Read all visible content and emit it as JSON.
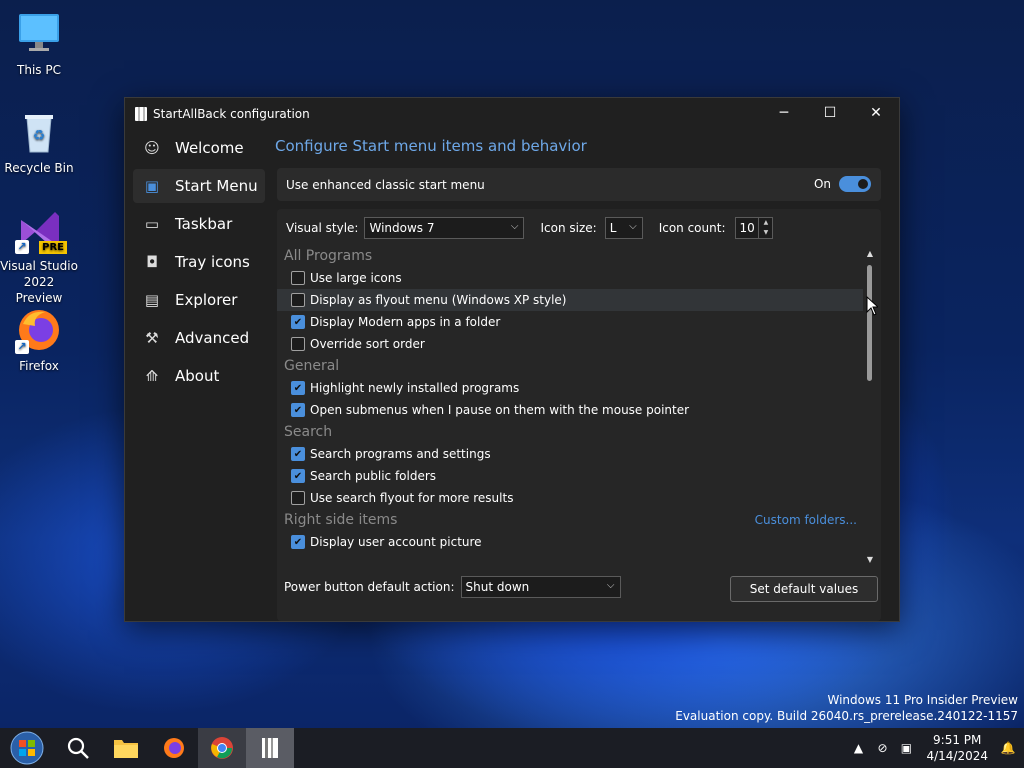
{
  "desktop": {
    "icons": [
      {
        "label": "This PC",
        "icon": "monitor-icon"
      },
      {
        "label": "Recycle Bin",
        "icon": "recycle-bin-icon"
      },
      {
        "label": "Visual Studio 2022 Preview",
        "badge": "PRE",
        "icon": "visual-studio-icon"
      },
      {
        "label": "Firefox",
        "icon": "firefox-icon"
      }
    ],
    "watermark": {
      "line1": "Windows 11 Pro Insider Preview",
      "line2": "Evaluation copy. Build 26040.rs_prerelease.240122-1157"
    }
  },
  "window": {
    "title": "StartAllBack configuration",
    "controls": {
      "minimize": "─",
      "maximize": "☐",
      "close": "✕"
    },
    "nav": [
      {
        "label": "Welcome",
        "icon": "smile-icon",
        "glyph": "☺"
      },
      {
        "label": "Start Menu",
        "icon": "start-menu-icon",
        "glyph": "▣"
      },
      {
        "label": "Taskbar",
        "icon": "taskbar-icon",
        "glyph": "▭"
      },
      {
        "label": "Tray icons",
        "icon": "tray-icon",
        "glyph": "◘"
      },
      {
        "label": "Explorer",
        "icon": "folder-icon",
        "glyph": "▤"
      },
      {
        "label": "Advanced",
        "icon": "wrench-icon",
        "glyph": "⚒"
      },
      {
        "label": "About",
        "icon": "info-icon",
        "glyph": "⟰"
      }
    ],
    "active_nav": "Start Menu",
    "page_title": "Configure Start menu items and behavior",
    "enhanced": {
      "label": "Use enhanced classic start menu",
      "state_label": "On",
      "on": true
    },
    "options": {
      "visual_style_label": "Visual style:",
      "visual_style_value": "Windows 7",
      "icon_size_label": "Icon size:",
      "icon_size_value": "L",
      "icon_count_label": "Icon count:",
      "icon_count_value": "10"
    },
    "sections": {
      "all_programs": "All Programs",
      "general": "General",
      "search": "Search",
      "right_side": "Right side items",
      "custom_folders_link": "Custom folders..."
    },
    "items": {
      "large_icons": {
        "label": "Use large icons",
        "checked": false
      },
      "flyout": {
        "label": "Display as flyout menu (Windows XP style)",
        "checked": false
      },
      "modern_apps": {
        "label": "Display Modern apps in a folder",
        "checked": true
      },
      "sort_order": {
        "label": "Override sort order",
        "checked": false
      },
      "highlight_new": {
        "label": "Highlight newly installed programs",
        "checked": true
      },
      "submenus": {
        "label": "Open submenus when I pause on them with the mouse pointer",
        "checked": true
      },
      "search_programs": {
        "label": "Search programs and settings",
        "checked": true
      },
      "search_public": {
        "label": "Search public folders",
        "checked": true
      },
      "search_flyout": {
        "label": "Use search flyout for more results",
        "checked": false
      },
      "account_picture": {
        "label": "Display user account picture",
        "checked": true
      }
    },
    "power": {
      "label": "Power button default action:",
      "value": "Shut down"
    },
    "default_button": "Set default values"
  },
  "taskbar": {
    "clock_time": "9:51 PM",
    "clock_date": "4/14/2024"
  }
}
